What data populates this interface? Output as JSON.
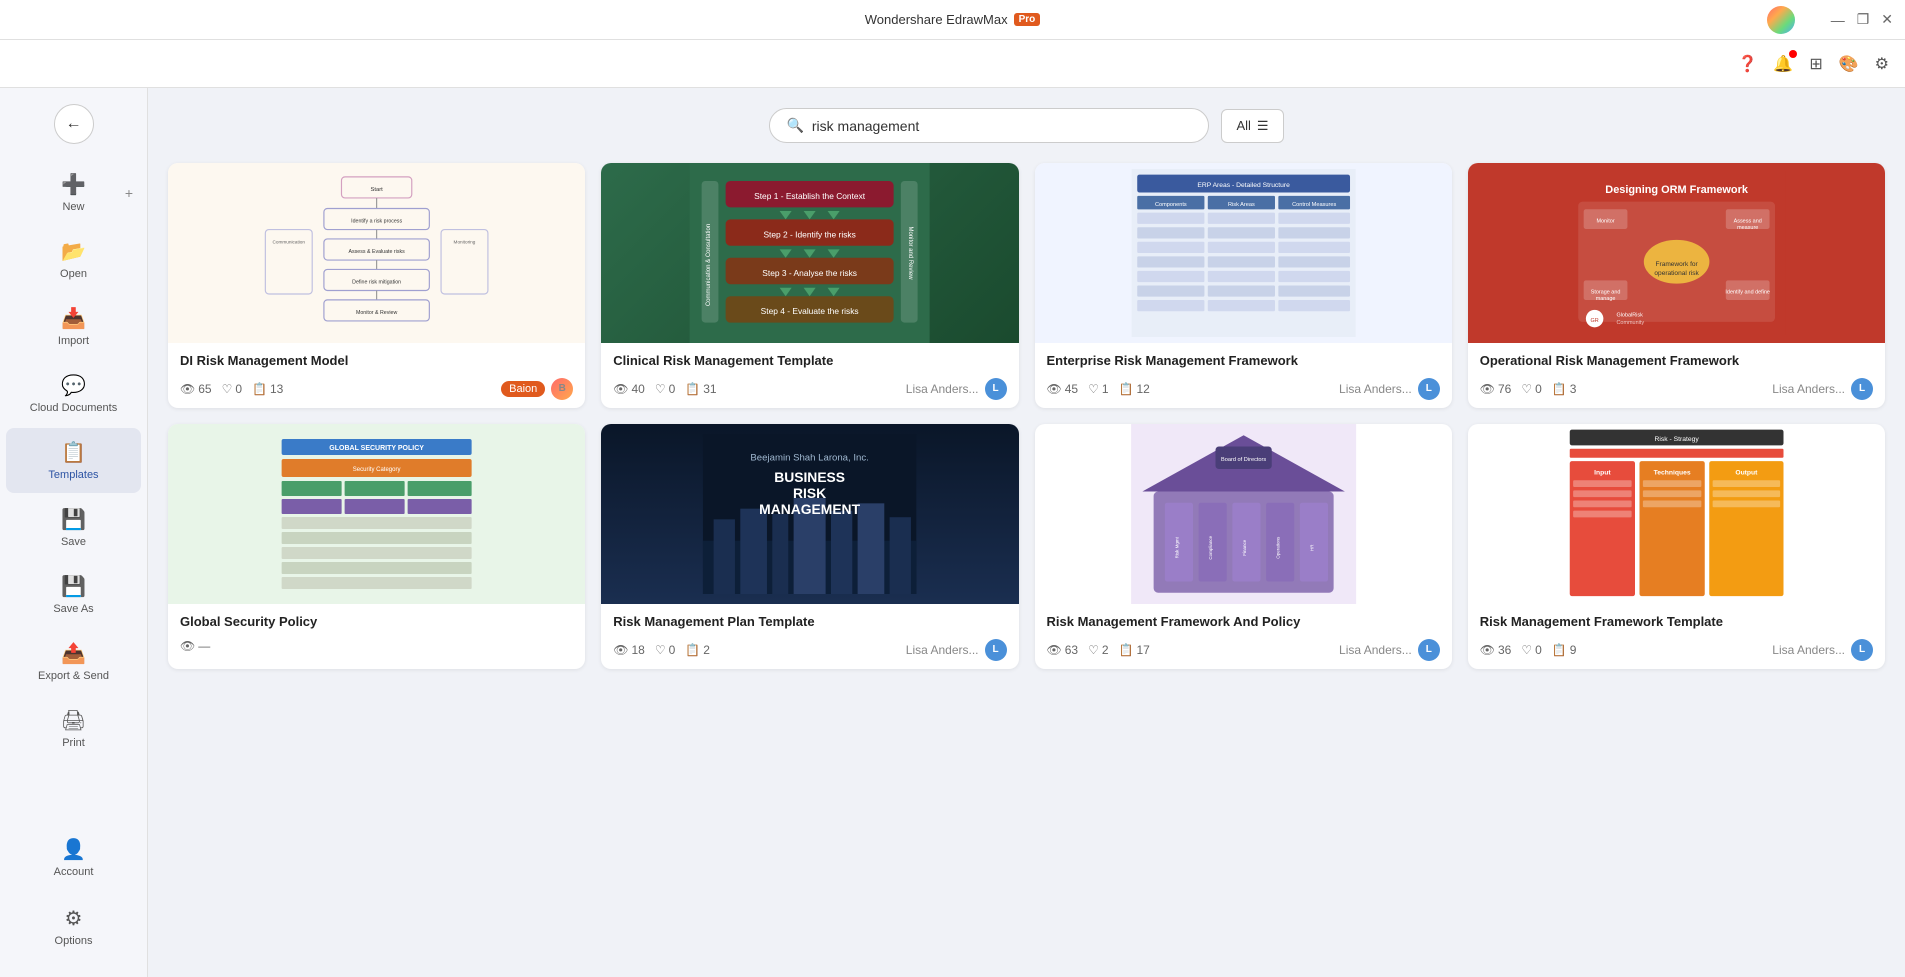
{
  "titleBar": {
    "title": "Wondershare EdrawMax",
    "proBadge": "Pro",
    "controls": {
      "minimize": "—",
      "maximize": "❐",
      "close": "✕"
    }
  },
  "toolbar": {
    "icons": [
      {
        "name": "help-icon",
        "symbol": "?",
        "hasBadge": false
      },
      {
        "name": "notification-icon",
        "symbol": "🔔",
        "hasBadge": true
      },
      {
        "name": "apps-icon",
        "symbol": "⊞",
        "hasBadge": false
      },
      {
        "name": "theme-icon",
        "symbol": "🎨",
        "hasBadge": false
      },
      {
        "name": "settings-icon",
        "symbol": "⚙",
        "hasBadge": false
      }
    ]
  },
  "sidebar": {
    "backButton": "←",
    "items": [
      {
        "id": "new",
        "label": "New",
        "icon": "➕",
        "active": false
      },
      {
        "id": "open",
        "label": "Open",
        "icon": "📁",
        "active": false
      },
      {
        "id": "import",
        "label": "Import",
        "icon": "📥",
        "active": false
      },
      {
        "id": "cloud",
        "label": "Cloud Documents",
        "icon": "💬",
        "active": false
      },
      {
        "id": "templates",
        "label": "Templates",
        "icon": "🗒",
        "active": true
      },
      {
        "id": "save",
        "label": "Save",
        "icon": "💾",
        "active": false
      },
      {
        "id": "saveas",
        "label": "Save As",
        "icon": "💾",
        "active": false
      },
      {
        "id": "export",
        "label": "Export & Send",
        "icon": "📤",
        "active": false
      },
      {
        "id": "print",
        "label": "Print",
        "icon": "🖨",
        "active": false
      }
    ],
    "bottomItems": [
      {
        "id": "account",
        "label": "Account",
        "icon": "👤",
        "active": false
      },
      {
        "id": "options",
        "label": "Options",
        "icon": "⚙",
        "active": false
      }
    ]
  },
  "search": {
    "placeholder": "risk management",
    "filterLabel": "All",
    "filterIcon": "☰"
  },
  "templates": [
    {
      "id": "di-risk",
      "title": "DI Risk Management Model",
      "views": 65,
      "likes": 0,
      "copies": 13,
      "author": "Baion",
      "authorType": "baion",
      "thumbType": "di-risk"
    },
    {
      "id": "clinical",
      "title": "Clinical Risk Management Template",
      "views": 40,
      "likes": 0,
      "copies": 31,
      "author": "Lisa Anders...",
      "authorType": "lisa",
      "thumbType": "clinical"
    },
    {
      "id": "enterprise",
      "title": "Enterprise Risk Management Framework",
      "views": 45,
      "likes": 1,
      "copies": 12,
      "author": "Lisa Anders...",
      "authorType": "lisa",
      "thumbType": "enterprise"
    },
    {
      "id": "orm",
      "title": "Operational Risk Management Framework",
      "views": 76,
      "likes": 0,
      "copies": 3,
      "author": "Lisa Anders...",
      "authorType": "lisa",
      "thumbType": "orm"
    },
    {
      "id": "global-security",
      "title": "Global Security Policy",
      "views": 0,
      "likes": 0,
      "copies": 0,
      "author": "",
      "authorType": "lisa",
      "thumbType": "global"
    },
    {
      "id": "biz-risk",
      "title": "Risk Management Plan Template",
      "views": 18,
      "likes": 0,
      "copies": 2,
      "author": "Lisa Anders...",
      "authorType": "lisa",
      "thumbType": "biz-risk"
    },
    {
      "id": "rm-framework-policy",
      "title": "Risk Management Framework And Policy",
      "views": 63,
      "likes": 2,
      "copies": 17,
      "author": "Lisa Anders...",
      "authorType": "lisa",
      "thumbType": "rm-framework"
    },
    {
      "id": "rm-strategy",
      "title": "Risk Management Framework Template",
      "views": 36,
      "likes": 0,
      "copies": 9,
      "author": "Lisa Anders...",
      "authorType": "lisa",
      "thumbType": "rm-strategy"
    }
  ]
}
